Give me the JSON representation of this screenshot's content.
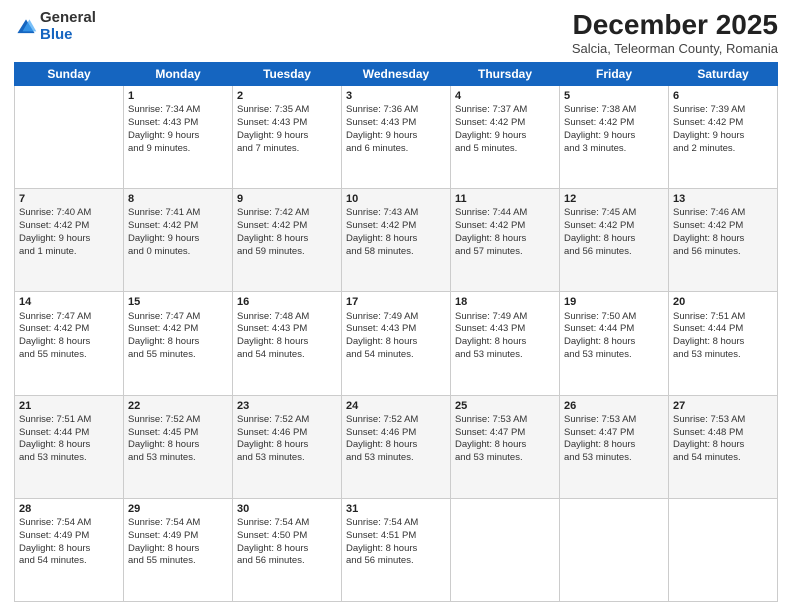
{
  "logo": {
    "general": "General",
    "blue": "Blue"
  },
  "title": {
    "month": "December 2025",
    "location": "Salcia, Teleorman County, Romania"
  },
  "days": [
    "Sunday",
    "Monday",
    "Tuesday",
    "Wednesday",
    "Thursday",
    "Friday",
    "Saturday"
  ],
  "weeks": [
    [
      {
        "day": "",
        "content": ""
      },
      {
        "day": "1",
        "content": "Sunrise: 7:34 AM\nSunset: 4:43 PM\nDaylight: 9 hours\nand 9 minutes."
      },
      {
        "day": "2",
        "content": "Sunrise: 7:35 AM\nSunset: 4:43 PM\nDaylight: 9 hours\nand 7 minutes."
      },
      {
        "day": "3",
        "content": "Sunrise: 7:36 AM\nSunset: 4:43 PM\nDaylight: 9 hours\nand 6 minutes."
      },
      {
        "day": "4",
        "content": "Sunrise: 7:37 AM\nSunset: 4:42 PM\nDaylight: 9 hours\nand 5 minutes."
      },
      {
        "day": "5",
        "content": "Sunrise: 7:38 AM\nSunset: 4:42 PM\nDaylight: 9 hours\nand 3 minutes."
      },
      {
        "day": "6",
        "content": "Sunrise: 7:39 AM\nSunset: 4:42 PM\nDaylight: 9 hours\nand 2 minutes."
      }
    ],
    [
      {
        "day": "7",
        "content": "Sunrise: 7:40 AM\nSunset: 4:42 PM\nDaylight: 9 hours\nand 1 minute."
      },
      {
        "day": "8",
        "content": "Sunrise: 7:41 AM\nSunset: 4:42 PM\nDaylight: 9 hours\nand 0 minutes."
      },
      {
        "day": "9",
        "content": "Sunrise: 7:42 AM\nSunset: 4:42 PM\nDaylight: 8 hours\nand 59 minutes."
      },
      {
        "day": "10",
        "content": "Sunrise: 7:43 AM\nSunset: 4:42 PM\nDaylight: 8 hours\nand 58 minutes."
      },
      {
        "day": "11",
        "content": "Sunrise: 7:44 AM\nSunset: 4:42 PM\nDaylight: 8 hours\nand 57 minutes."
      },
      {
        "day": "12",
        "content": "Sunrise: 7:45 AM\nSunset: 4:42 PM\nDaylight: 8 hours\nand 56 minutes."
      },
      {
        "day": "13",
        "content": "Sunrise: 7:46 AM\nSunset: 4:42 PM\nDaylight: 8 hours\nand 56 minutes."
      }
    ],
    [
      {
        "day": "14",
        "content": "Sunrise: 7:47 AM\nSunset: 4:42 PM\nDaylight: 8 hours\nand 55 minutes."
      },
      {
        "day": "15",
        "content": "Sunrise: 7:47 AM\nSunset: 4:42 PM\nDaylight: 8 hours\nand 55 minutes."
      },
      {
        "day": "16",
        "content": "Sunrise: 7:48 AM\nSunset: 4:43 PM\nDaylight: 8 hours\nand 54 minutes."
      },
      {
        "day": "17",
        "content": "Sunrise: 7:49 AM\nSunset: 4:43 PM\nDaylight: 8 hours\nand 54 minutes."
      },
      {
        "day": "18",
        "content": "Sunrise: 7:49 AM\nSunset: 4:43 PM\nDaylight: 8 hours\nand 53 minutes."
      },
      {
        "day": "19",
        "content": "Sunrise: 7:50 AM\nSunset: 4:44 PM\nDaylight: 8 hours\nand 53 minutes."
      },
      {
        "day": "20",
        "content": "Sunrise: 7:51 AM\nSunset: 4:44 PM\nDaylight: 8 hours\nand 53 minutes."
      }
    ],
    [
      {
        "day": "21",
        "content": "Sunrise: 7:51 AM\nSunset: 4:44 PM\nDaylight: 8 hours\nand 53 minutes."
      },
      {
        "day": "22",
        "content": "Sunrise: 7:52 AM\nSunset: 4:45 PM\nDaylight: 8 hours\nand 53 minutes."
      },
      {
        "day": "23",
        "content": "Sunrise: 7:52 AM\nSunset: 4:46 PM\nDaylight: 8 hours\nand 53 minutes."
      },
      {
        "day": "24",
        "content": "Sunrise: 7:52 AM\nSunset: 4:46 PM\nDaylight: 8 hours\nand 53 minutes."
      },
      {
        "day": "25",
        "content": "Sunrise: 7:53 AM\nSunset: 4:47 PM\nDaylight: 8 hours\nand 53 minutes."
      },
      {
        "day": "26",
        "content": "Sunrise: 7:53 AM\nSunset: 4:47 PM\nDaylight: 8 hours\nand 53 minutes."
      },
      {
        "day": "27",
        "content": "Sunrise: 7:53 AM\nSunset: 4:48 PM\nDaylight: 8 hours\nand 54 minutes."
      }
    ],
    [
      {
        "day": "28",
        "content": "Sunrise: 7:54 AM\nSunset: 4:49 PM\nDaylight: 8 hours\nand 54 minutes."
      },
      {
        "day": "29",
        "content": "Sunrise: 7:54 AM\nSunset: 4:49 PM\nDaylight: 8 hours\nand 55 minutes."
      },
      {
        "day": "30",
        "content": "Sunrise: 7:54 AM\nSunset: 4:50 PM\nDaylight: 8 hours\nand 56 minutes."
      },
      {
        "day": "31",
        "content": "Sunrise: 7:54 AM\nSunset: 4:51 PM\nDaylight: 8 hours\nand 56 minutes."
      },
      {
        "day": "",
        "content": ""
      },
      {
        "day": "",
        "content": ""
      },
      {
        "day": "",
        "content": ""
      }
    ]
  ]
}
